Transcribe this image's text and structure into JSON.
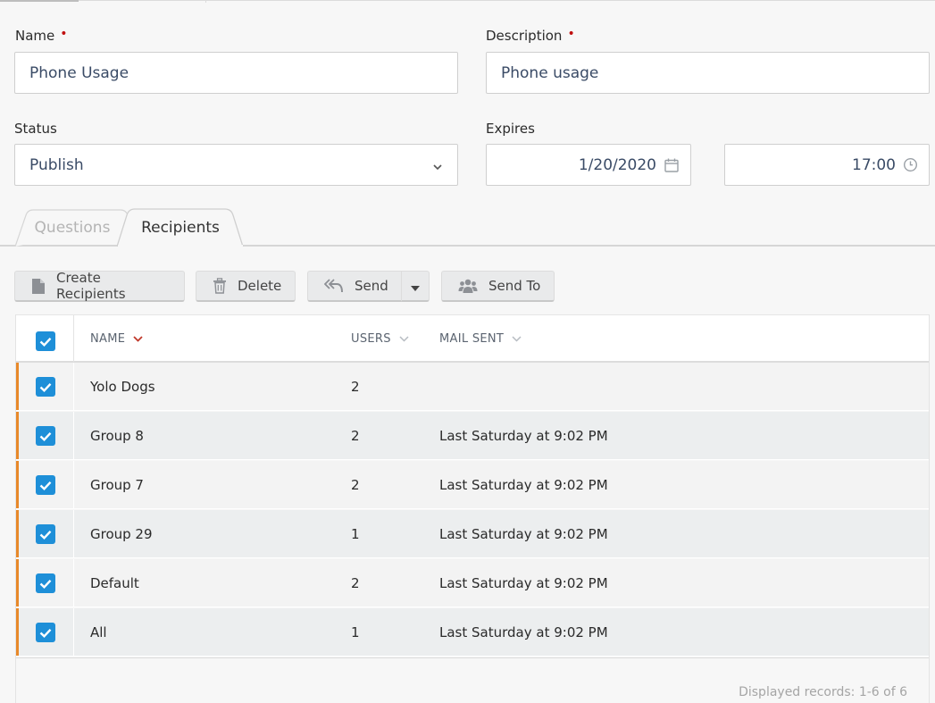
{
  "form": {
    "name_label": "Name",
    "name_value": "Phone Usage",
    "description_label": "Description",
    "description_value": "Phone usage",
    "required_marker": "•",
    "status_label": "Status",
    "status_value": "Publish",
    "expires_label": "Expires",
    "expires_date": "1/20/2020",
    "expires_time": "17:00"
  },
  "tabs": [
    {
      "label": "Questions",
      "active": false
    },
    {
      "label": "Recipients",
      "active": true
    }
  ],
  "toolbar": {
    "create_label": "Create Recipients",
    "delete_label": "Delete",
    "send_label": "Send",
    "send_to_label": "Send To"
  },
  "grid": {
    "columns": [
      "NAME",
      "USERS",
      "MAIL SENT"
    ],
    "rows": [
      {
        "name": "Yolo Dogs",
        "users": "2",
        "mail_sent": ""
      },
      {
        "name": "Group 8",
        "users": "2",
        "mail_sent": "Last Saturday at 9:02 PM"
      },
      {
        "name": "Group 7",
        "users": "2",
        "mail_sent": "Last Saturday at 9:02 PM"
      },
      {
        "name": "Group 29",
        "users": "1",
        "mail_sent": "Last Saturday at 9:02 PM"
      },
      {
        "name": "Default",
        "users": "2",
        "mail_sent": "Last Saturday at 9:02 PM"
      },
      {
        "name": "All",
        "users": "1",
        "mail_sent": "Last Saturday at 9:02 PM"
      }
    ],
    "footer": "Displayed records: 1-6 of 6"
  },
  "colors": {
    "accent": "#1e8fd8",
    "row_marker": "#e8892a",
    "required": "#c01010",
    "sort_indicator": "#c0392b"
  }
}
